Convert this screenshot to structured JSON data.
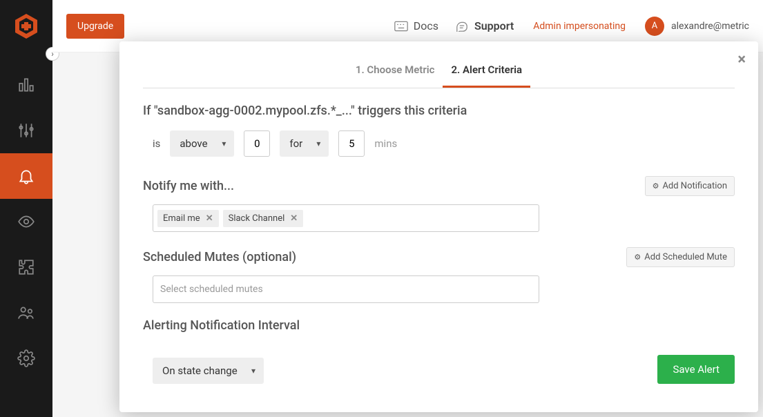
{
  "sidebar": {
    "expand_glyph": "›"
  },
  "topbar": {
    "upgrade": "Upgrade",
    "docs": "Docs",
    "support": "Support",
    "impersonating": "Admin impersonating",
    "avatar_initial": "A",
    "user_email": "alexandre@metric"
  },
  "modal": {
    "close": "×",
    "tabs": {
      "choose_metric": "1. Choose Metric",
      "alert_criteria": "2. Alert Criteria"
    },
    "criteria_heading": "If \"sandbox-agg-0002.mypool.zfs.*_...\" triggers this criteria",
    "criteria": {
      "is": "is",
      "comparator": "above",
      "threshold": "0",
      "for": "for",
      "duration": "5",
      "mins": "mins"
    },
    "notify": {
      "title": "Notify me with...",
      "add_btn": "Add Notification",
      "tags": [
        "Email me",
        "Slack Channel"
      ]
    },
    "mutes": {
      "title": "Scheduled Mutes (optional)",
      "add_btn": "Add Scheduled Mute",
      "placeholder": "Select scheduled mutes"
    },
    "interval": {
      "title": "Alerting Notification Interval",
      "value": "On state change"
    },
    "save": "Save Alert"
  }
}
